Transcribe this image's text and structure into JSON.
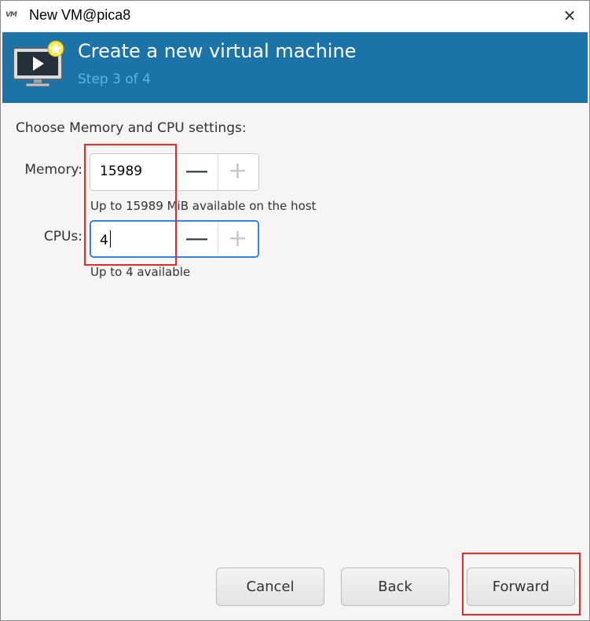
{
  "window": {
    "title": "New VM@pica8",
    "logo_text": "VM",
    "close_glyph": "✕"
  },
  "header": {
    "title": "Create a new virtual machine",
    "subtitle": "Step 3 of 4",
    "icon": "new-vm-icon",
    "background_color": "#1b73a8"
  },
  "body": {
    "prompt": "Choose Memory and CPU settings:",
    "memory": {
      "label": "Memory:",
      "value": "15989",
      "hint": "Up to 15989 MiB available on the host"
    },
    "cpus": {
      "label": "CPUs:",
      "value": "4",
      "hint": "Up to 4 available"
    },
    "decrement_glyph": "—",
    "increment_glyph": "+"
  },
  "footer": {
    "cancel_label": "Cancel",
    "back_label": "Back",
    "forward_label": "Forward"
  },
  "annotation_color": "#e02b2b"
}
